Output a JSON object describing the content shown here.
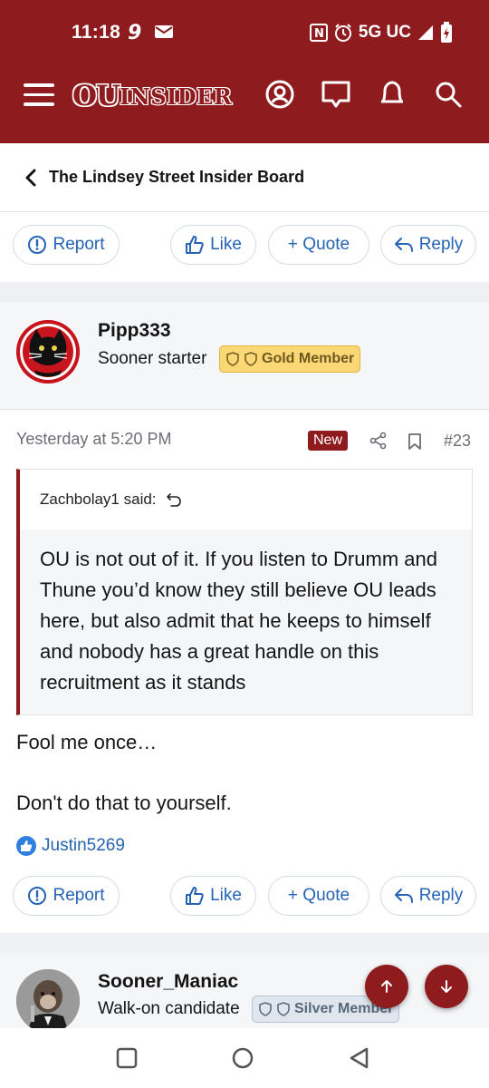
{
  "status_bar": {
    "time": "11:18",
    "network": "5G UC"
  },
  "header": {
    "logo_ou": "OU",
    "logo_insider": "INSIDER",
    "brand_color": "#8e1b1e"
  },
  "breadcrumb": {
    "label": "The Lindsey Street Insider Board"
  },
  "actions": {
    "report": "Report",
    "like": "Like",
    "quote": "+ Quote",
    "reply": "Reply"
  },
  "post": {
    "author": "Pipp333",
    "user_title": "Sooner starter",
    "badge": "Gold Member",
    "date": "Yesterday at 5:20 PM",
    "new_label": "New",
    "number": "#23",
    "quote_author": "Zachbolay1 said:",
    "quote_text": "OU is not out of it. If you listen to Drumm and Thune you’d know they still believe OU leads here, but also admit that he keeps to himself and nobody has a great handle on this recruitment as it stands",
    "body_line1": "Fool me once…",
    "body_line2": "Don't do that to yourself.",
    "reaction_user": "Justin5269"
  },
  "next_post": {
    "author": "Sooner_Maniac",
    "user_title": "Walk-on candidate",
    "badge": "Silver Member"
  }
}
